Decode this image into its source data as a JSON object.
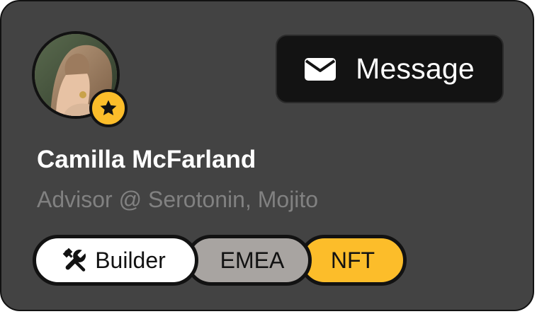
{
  "profile": {
    "name": "Camilla McFarland",
    "subtitle": "Advisor @ Serotonin, Mojito",
    "avatar_badge_icon": "star-icon"
  },
  "actions": {
    "message_label": "Message",
    "message_icon": "envelope-icon"
  },
  "tags": [
    {
      "label": "Builder",
      "icon": "tools-icon",
      "color": "#ffffff"
    },
    {
      "label": "EMEA",
      "color": "#a8a4a1"
    },
    {
      "label": "NFT",
      "color": "#fcbd2a"
    }
  ],
  "colors": {
    "card_bg": "#434343",
    "button_bg": "#131313",
    "accent": "#fcbd2a",
    "outline": "#121212",
    "subtitle_text": "#818181"
  }
}
